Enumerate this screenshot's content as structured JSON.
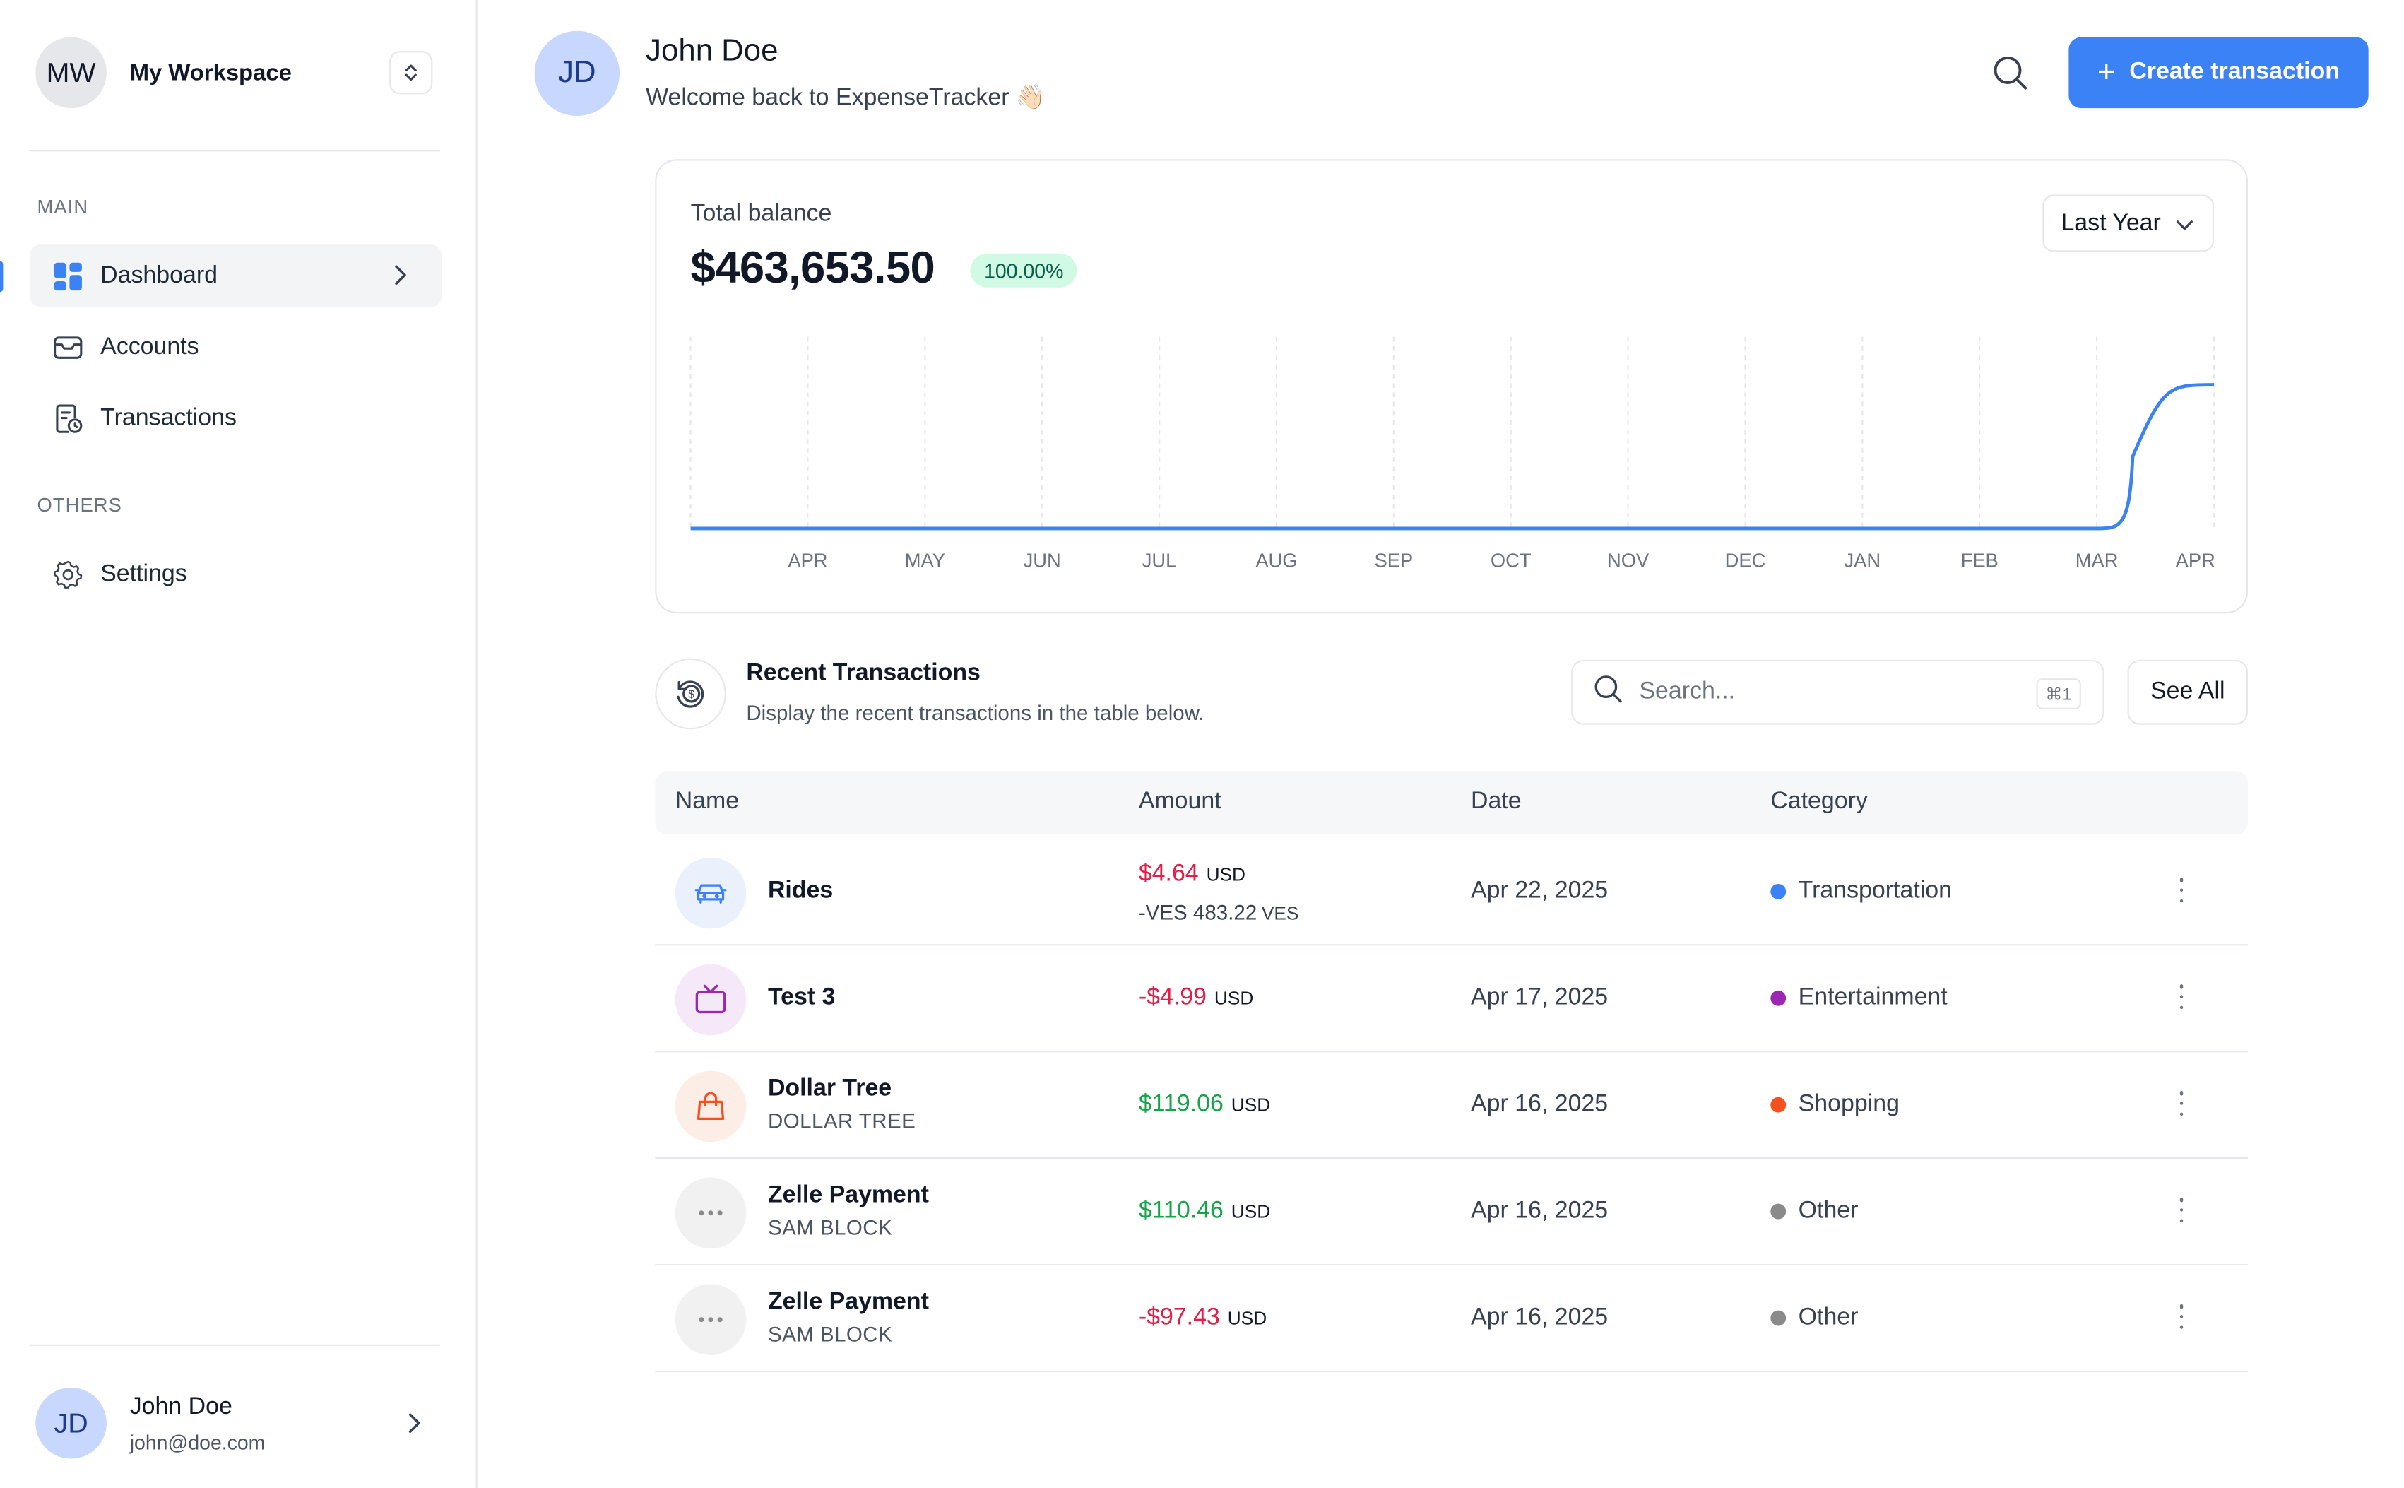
{
  "workspace": {
    "initials": "MW",
    "name": "My Workspace"
  },
  "sidebar": {
    "main_label": "MAIN",
    "others_label": "OTHERS",
    "items": [
      {
        "label": "Dashboard",
        "icon": "dashboard-icon",
        "active": true
      },
      {
        "label": "Accounts",
        "icon": "inbox-icon"
      },
      {
        "label": "Transactions",
        "icon": "receipt-clock-icon"
      }
    ],
    "others": [
      {
        "label": "Settings",
        "icon": "gear-icon"
      }
    ]
  },
  "user": {
    "initials": "JD",
    "name": "John Doe",
    "email": "john@doe.com"
  },
  "header": {
    "initials": "JD",
    "name": "John Doe",
    "welcome": "Welcome back to ExpenseTracker 👋🏻",
    "create_label": "Create transaction"
  },
  "balance": {
    "label": "Total balance",
    "amount": "$463,653.50",
    "change": "100.00%",
    "period": "Last Year"
  },
  "chart_data": {
    "type": "line",
    "categories": [
      "",
      "APR",
      "MAY",
      "JUN",
      "JUL",
      "AUG",
      "SEP",
      "OCT",
      "NOV",
      "DEC",
      "JAN",
      "FEB",
      "MAR",
      "APR"
    ],
    "values": [
      0,
      0,
      0,
      0,
      0,
      0,
      0,
      0,
      0,
      0,
      0,
      0,
      0,
      463653.5
    ],
    "grid": true,
    "color": "#3b82f6"
  },
  "recent": {
    "title": "Recent Transactions",
    "subtitle": "Display the recent transactions in the table below.",
    "search_placeholder": "Search...",
    "kbd": "⌘1",
    "see_all": "See All"
  },
  "table": {
    "headers": {
      "name": "Name",
      "amount": "Amount",
      "date": "Date",
      "category": "Category"
    },
    "rows": [
      {
        "icon": "car-icon",
        "name": "Rides",
        "sub": "",
        "amount": "$4.64",
        "currency": "USD",
        "amount2": "-VES 483.22",
        "currency2": "VES",
        "sign": "red",
        "date": "Apr 22, 2025",
        "category": "Transportation",
        "cat_color": "#3b82f6",
        "icon_bg": "#eaf1fd",
        "icon_color": "#3b82f6"
      },
      {
        "icon": "tv-icon",
        "name": "Test 3",
        "sub": "",
        "amount": "-$4.99",
        "currency": "USD",
        "sign": "red",
        "date": "Apr 17, 2025",
        "category": "Entertainment",
        "cat_color": "#9c27b0",
        "icon_bg": "#f5e8f8",
        "icon_color": "#9c27b0"
      },
      {
        "icon": "shopping-bag-icon",
        "name": "Dollar Tree",
        "sub": "DOLLAR TREE",
        "amount": "$119.06",
        "currency": "USD",
        "sign": "green",
        "date": "Apr 16, 2025",
        "category": "Shopping",
        "cat_color": "#f4511e",
        "icon_bg": "#fdede7",
        "icon_color": "#f4511e"
      },
      {
        "icon": "more-horizontal-icon",
        "name": "Zelle Payment",
        "sub": "SAM BLOCK",
        "amount": "$110.46",
        "currency": "USD",
        "sign": "green",
        "date": "Apr 16, 2025",
        "category": "Other",
        "cat_color": "#8a8a8a",
        "icon_bg": "#f1f1f1",
        "icon_color": "#8a8a8a"
      },
      {
        "icon": "more-horizontal-icon",
        "name": "Zelle Payment",
        "sub": "SAM BLOCK",
        "amount": "-$97.43",
        "currency": "USD",
        "sign": "red",
        "date": "Apr 16, 2025",
        "category": "Other",
        "cat_color": "#8a8a8a",
        "icon_bg": "#f1f1f1",
        "icon_color": "#8a8a8a"
      }
    ]
  }
}
